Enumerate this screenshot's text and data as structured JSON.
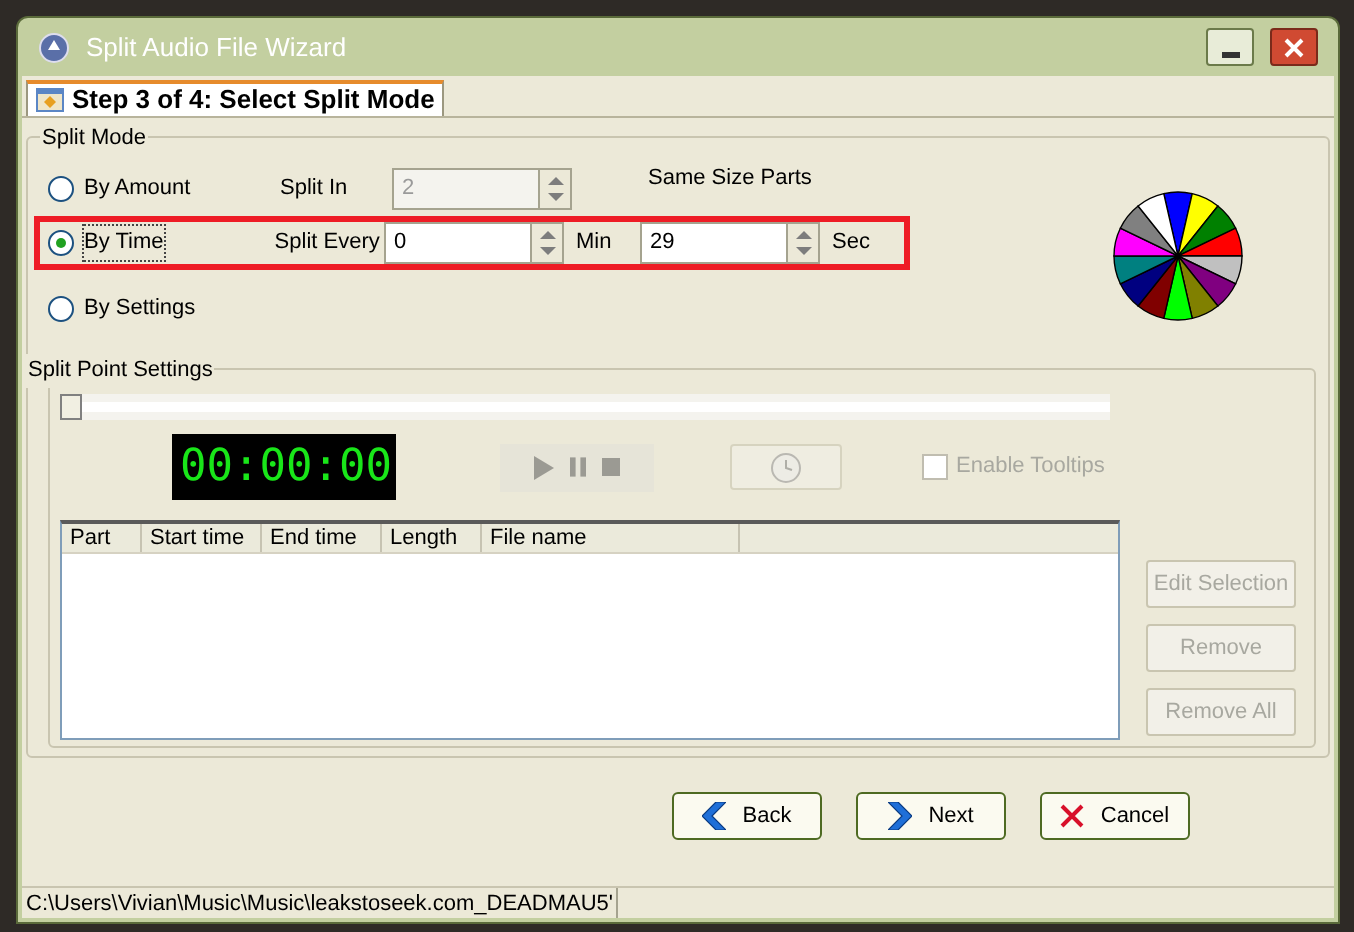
{
  "window": {
    "title": "Split Audio File Wizard"
  },
  "tabs": [
    {
      "label": "Step 3 of 4: Select Split Mode",
      "selected": true
    }
  ],
  "split_mode": {
    "title": "Split Mode",
    "modes": [
      {
        "label": "By Amount",
        "selected": false,
        "field_label": "Split In",
        "fields": [
          {
            "value": "2",
            "disabled": true
          }
        ],
        "note": "Same Size Parts"
      },
      {
        "label": "By Time",
        "selected": true,
        "highlighted": true,
        "field_label": "Split Every",
        "fields": [
          {
            "value": "0",
            "unit": "Min",
            "disabled": false
          },
          {
            "value": "29",
            "unit": "Sec",
            "disabled": false
          }
        ]
      },
      {
        "label": "By Settings",
        "selected": false
      }
    ]
  },
  "split_point_settings": {
    "title": "Split Point Settings",
    "position": {
      "level": 0
    },
    "time_display": "00:00:00",
    "transport_disabled": true,
    "enable_tooltips": {
      "label": "Enable Tooltips",
      "checked": false,
      "disabled": true
    },
    "table": {
      "columns": [
        "Part",
        "Start time",
        "End time",
        "Length",
        "File name"
      ]
    },
    "actions": [
      {
        "label": "Edit Selection",
        "disabled": true
      },
      {
        "label": "Remove",
        "disabled": true
      },
      {
        "label": "Remove All",
        "disabled": true
      }
    ]
  },
  "buttons": [
    {
      "label": "Back",
      "kind": "back"
    },
    {
      "label": "Next",
      "kind": "next"
    },
    {
      "label": "Cancel",
      "kind": "cancel"
    }
  ],
  "status_bar": "C:\\Users\\Vivian\\Music\\Music\\leakstoseek.com_DEADMAU5'"
}
